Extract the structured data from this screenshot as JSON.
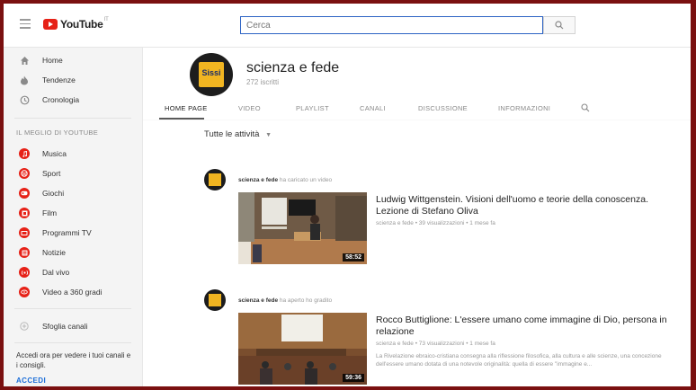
{
  "header": {
    "logo_text": "YouTube",
    "logo_sup": "IT",
    "search_placeholder": "Cerca"
  },
  "sidebar": {
    "main_items": [
      {
        "label": "Home",
        "icon": "home-icon"
      },
      {
        "label": "Tendenze",
        "icon": "flame-icon"
      },
      {
        "label": "Cronologia",
        "icon": "history-icon"
      }
    ],
    "section_title": "IL MEGLIO DI YOUTUBE",
    "category_items": [
      {
        "label": "Musica",
        "icon": "music-icon"
      },
      {
        "label": "Sport",
        "icon": "sport-icon"
      },
      {
        "label": "Giochi",
        "icon": "gaming-icon"
      },
      {
        "label": "Film",
        "icon": "film-icon"
      },
      {
        "label": "Programmi TV",
        "icon": "tv-icon"
      },
      {
        "label": "Notizie",
        "icon": "news-icon"
      },
      {
        "label": "Dal vivo",
        "icon": "live-icon"
      },
      {
        "label": "Video a 360 gradi",
        "icon": "360-icon"
      }
    ],
    "browse_channels": "Sfoglia canali",
    "promo_text": "Accedi ora per vedere i tuoi canali e i consigli.",
    "signin_label": "ACCEDI"
  },
  "channel": {
    "name": "scienza e fede",
    "avatar_text": "Sissi",
    "subscribers": "272 iscritti",
    "tabs": [
      "HOME PAGE",
      "VIDEO",
      "PLAYLIST",
      "CANALI",
      "DISCUSSIONE",
      "INFORMAZIONI"
    ]
  },
  "feed": {
    "filter_label": "Tutte le attività",
    "posts": [
      {
        "author": "scienza e fede",
        "action": "ha caricato un video",
        "title": "Ludwig Wittgenstein. Visioni dell'uomo e teorie della conoscenza. Lezione di Stefano Oliva",
        "meta": "scienza e fede • 39 visualizzazioni • 1 mese fa",
        "description": "",
        "duration": "58:52"
      },
      {
        "author": "scienza e fede",
        "action": "ha aperto ho gradito",
        "title": "Rocco Buttiglione: L'essere umano come immagine di Dio, persona in relazione",
        "meta": "scienza e fede • 73 visualizzazioni • 1 mese fa",
        "description": "La Rivelazione ebraico-cristiana consegna alla riflessione filosofica, alla cultura e alle scienze, una concezione dell'essere umano dotata di una notevole originalità: quella di essere \"immagine e...",
        "duration": "59:36"
      }
    ]
  }
}
